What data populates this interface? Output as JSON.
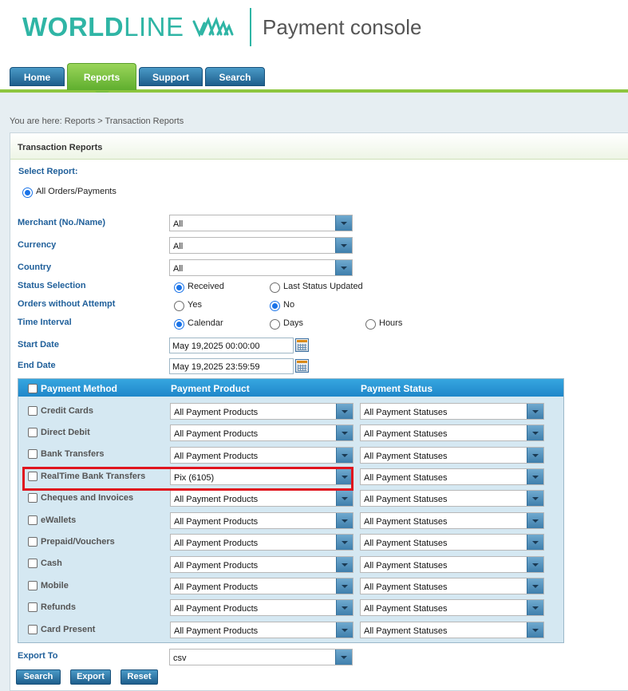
{
  "header": {
    "logo_world": "WORLD",
    "logo_line": "LINE",
    "console_title": "Payment console",
    "brand_color": "#2fb5a5"
  },
  "nav": {
    "tabs": [
      {
        "label": "Home",
        "active": false
      },
      {
        "label": "Reports",
        "active": true
      },
      {
        "label": "Support",
        "active": false
      },
      {
        "label": "Search",
        "active": false
      }
    ]
  },
  "breadcrumb": "You are here: Reports > Transaction Reports",
  "panel_title": "Transaction Reports",
  "form": {
    "select_report_label": "Select Report:",
    "report_option": "All Orders/Payments",
    "merchant_label": "Merchant (No./Name)",
    "merchant_value": "All",
    "currency_label": "Currency",
    "currency_value": "All",
    "country_label": "Country",
    "country_value": "All",
    "status_selection_label": "Status Selection",
    "status_received": "Received",
    "status_last_updated": "Last Status Updated",
    "orders_without_attempt_label": "Orders without Attempt",
    "owa_yes": "Yes",
    "owa_no": "No",
    "time_interval_label": "Time Interval",
    "ti_calendar": "Calendar",
    "ti_days": "Days",
    "ti_hours": "Hours",
    "start_date_label": "Start Date",
    "start_date_value": "May 19,2025 00:00:00",
    "end_date_label": "End Date",
    "end_date_value": "May 19,2025 23:59:59",
    "export_to_label": "Export To",
    "export_to_value": "csv"
  },
  "payment_table": {
    "headers": {
      "method": "Payment Method",
      "product": "Payment Product",
      "status": "Payment Status"
    },
    "rows": [
      {
        "method": "Credit Cards",
        "product": "All Payment Products",
        "status": "All Payment Statuses"
      },
      {
        "method": "Direct Debit",
        "product": "All Payment Products",
        "status": "All Payment Statuses"
      },
      {
        "method": "Bank Transfers",
        "product": "All Payment Products",
        "status": "All Payment Statuses"
      },
      {
        "method": "RealTime Bank Transfers",
        "product": "Pix (6105)",
        "status": "All Payment Statuses"
      },
      {
        "method": "Cheques and Invoices",
        "product": "All Payment Products",
        "status": "All Payment Statuses"
      },
      {
        "method": "eWallets",
        "product": "All Payment Products",
        "status": "All Payment Statuses"
      },
      {
        "method": "Prepaid/Vouchers",
        "product": "All Payment Products",
        "status": "All Payment Statuses"
      },
      {
        "method": "Cash",
        "product": "All Payment Products",
        "status": "All Payment Statuses"
      },
      {
        "method": "Mobile",
        "product": "All Payment Products",
        "status": "All Payment Statuses"
      },
      {
        "method": "Refunds",
        "product": "All Payment Products",
        "status": "All Payment Statuses"
      },
      {
        "method": "Card Present",
        "product": "All Payment Products",
        "status": "All Payment Statuses"
      }
    ]
  },
  "buttons": {
    "search": "Search",
    "export": "Export",
    "reset": "Reset"
  },
  "icons": {
    "calendar": "calendar-icon",
    "dropdown": "chevron-down-icon",
    "logo_mark": "worldline-waves-icon"
  }
}
